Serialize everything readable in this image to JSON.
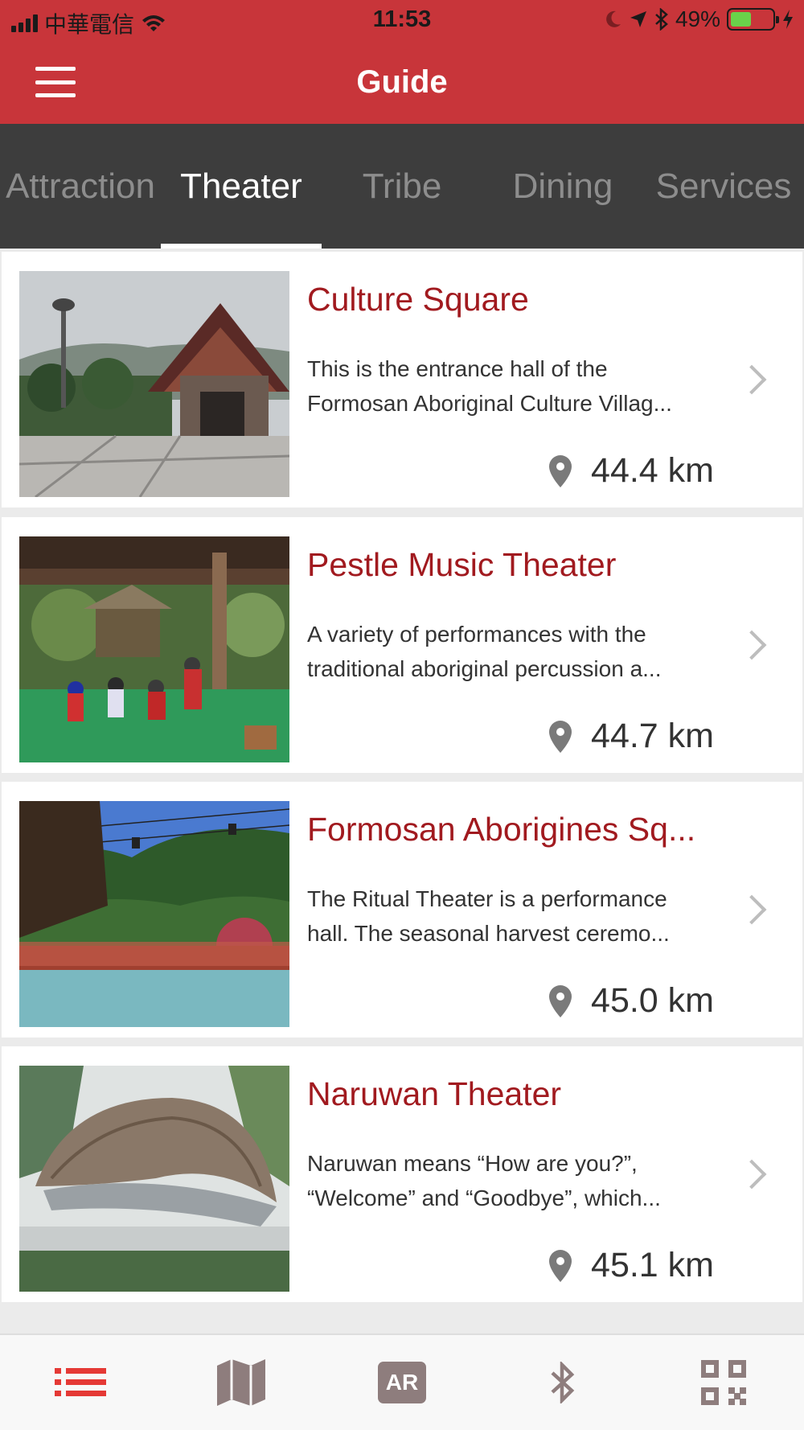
{
  "status_bar": {
    "carrier": "中華電信",
    "time": "11:53",
    "battery_percent": "49%",
    "battery_level": 0.49,
    "icons": [
      "signal-icon",
      "wifi-icon",
      "moon-icon",
      "location-arrow-icon",
      "bluetooth-icon",
      "battery-icon",
      "charging-icon"
    ]
  },
  "app_bar": {
    "title": "Guide",
    "menu_icon": "hamburger-menu-icon"
  },
  "tabs": [
    {
      "label": "Attraction",
      "active": false
    },
    {
      "label": "Theater",
      "active": true
    },
    {
      "label": "Tribe",
      "active": false
    },
    {
      "label": "Dining",
      "active": false
    },
    {
      "label": "Services",
      "active": false
    }
  ],
  "items": [
    {
      "title": "Culture Square",
      "desc_line1": "This is the entrance hall of the",
      "desc_line2": "Formosan Aboriginal Culture Villag...",
      "distance": "44.4 km"
    },
    {
      "title": "Pestle Music Theater",
      "desc_line1": "A variety of performances with the",
      "desc_line2": "traditional aboriginal percussion a...",
      "distance": "44.7 km"
    },
    {
      "title": "Formosan Aborigines Sq...",
      "desc_line1": "The Ritual Theater is a performance",
      "desc_line2": "hall. The seasonal harvest ceremo...",
      "distance": "45.0 km"
    },
    {
      "title": "Naruwan Theater",
      "desc_line1": "Naruwan means “How are you?”,",
      "desc_line2": "“Welcome” and “Goodbye”, which...",
      "distance": "45.1 km"
    }
  ],
  "bottom_nav": {
    "items": [
      {
        "icon": "list-icon",
        "active": true
      },
      {
        "icon": "map-icon",
        "active": false
      },
      {
        "icon": "ar-icon",
        "label": "AR",
        "active": false
      },
      {
        "icon": "bluetooth-icon",
        "active": false
      },
      {
        "icon": "qr-code-icon",
        "active": false
      }
    ]
  },
  "colors": {
    "brand_red": "#c8353a",
    "title_red": "#a11a1f",
    "tab_bar": "#3d3d3d",
    "active_nav": "#e53935",
    "inactive_nav": "#8e7d7d"
  }
}
